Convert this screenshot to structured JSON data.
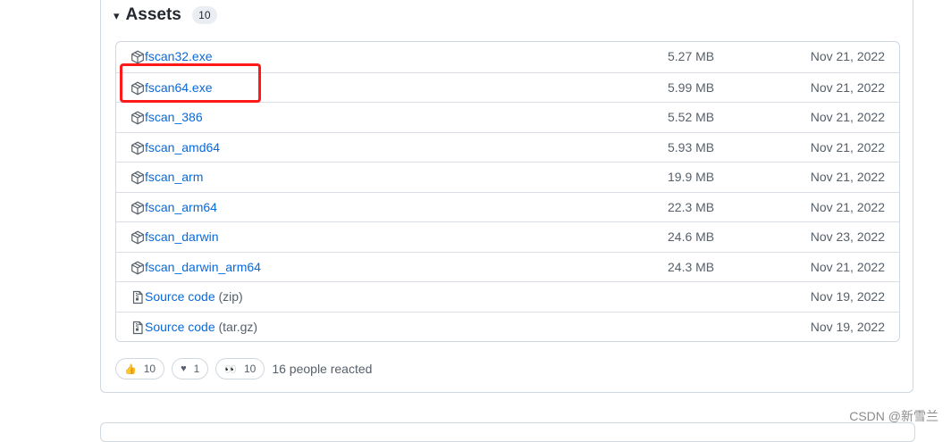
{
  "assets": {
    "caret": "▾",
    "title": "Assets",
    "count": "10",
    "items": [
      {
        "name": "fscan32.exe",
        "suffix": "",
        "size": "5.27 MB",
        "date": "Nov 21, 2022",
        "icon": "package-icon"
      },
      {
        "name": "fscan64.exe",
        "suffix": "",
        "size": "5.99 MB",
        "date": "Nov 21, 2022",
        "icon": "package-icon"
      },
      {
        "name": "fscan_386",
        "suffix": "",
        "size": "5.52 MB",
        "date": "Nov 21, 2022",
        "icon": "package-icon"
      },
      {
        "name": "fscan_amd64",
        "suffix": "",
        "size": "5.93 MB",
        "date": "Nov 21, 2022",
        "icon": "package-icon"
      },
      {
        "name": "fscan_arm",
        "suffix": "",
        "size": "19.9 MB",
        "date": "Nov 21, 2022",
        "icon": "package-icon"
      },
      {
        "name": "fscan_arm64",
        "suffix": "",
        "size": "22.3 MB",
        "date": "Nov 21, 2022",
        "icon": "package-icon"
      },
      {
        "name": "fscan_darwin",
        "suffix": "",
        "size": "24.6 MB",
        "date": "Nov 23, 2022",
        "icon": "package-icon"
      },
      {
        "name": "fscan_darwin_arm64",
        "suffix": "",
        "size": "24.3 MB",
        "date": "Nov 21, 2022",
        "icon": "package-icon"
      },
      {
        "name": "Source code",
        "suffix": "(zip)",
        "size": "",
        "date": "Nov 19, 2022",
        "icon": "file-zip-icon"
      },
      {
        "name": "Source code",
        "suffix": "(tar.gz)",
        "size": "",
        "date": "Nov 19, 2022",
        "icon": "file-zip-icon"
      }
    ]
  },
  "reactions": {
    "items": [
      {
        "emoji": "👍",
        "icon": "thumbs-up-icon",
        "count": "10"
      },
      {
        "emoji": "♥",
        "icon": "heart-icon",
        "count": "1"
      },
      {
        "emoji": "👀",
        "icon": "eyes-icon",
        "count": "10"
      }
    ],
    "summary": "16 people reacted"
  },
  "watermark": "CSDN @新雪兰",
  "colors": {
    "link": "#0969da",
    "muted": "#57606a",
    "highlight": "#ff1a1a"
  }
}
